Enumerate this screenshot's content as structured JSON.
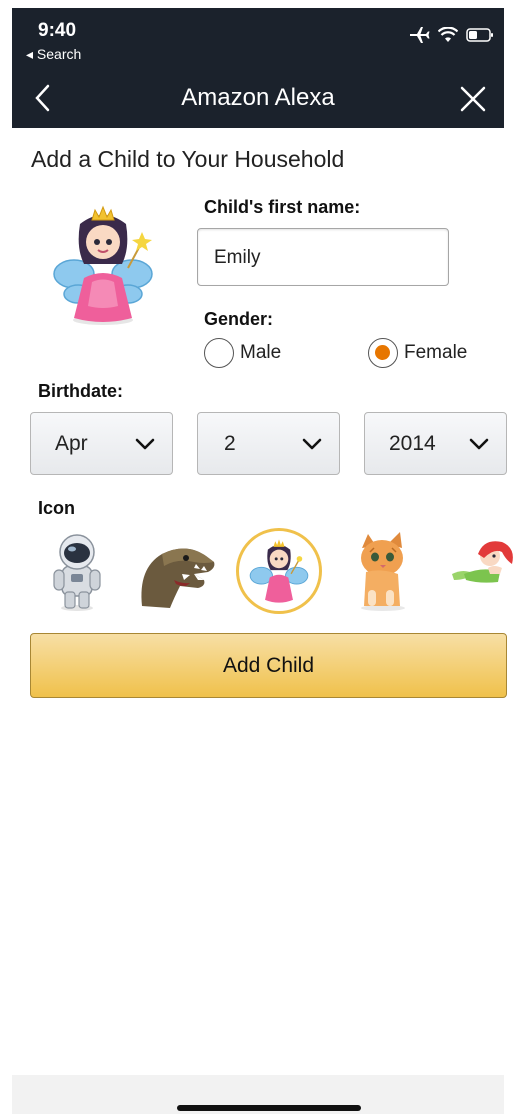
{
  "status_bar": {
    "time": "9:40",
    "back_app": "◂ Search"
  },
  "nav": {
    "title": "Amazon Alexa"
  },
  "page": {
    "heading": "Add a Child to Your Household"
  },
  "form": {
    "first_name_label": "Child's first name:",
    "first_name_value": "Emily",
    "gender_label": "Gender:",
    "gender_options": [
      {
        "label": "Male",
        "selected": false
      },
      {
        "label": "Female",
        "selected": true
      }
    ],
    "birthdate_label": "Birthdate:",
    "birth_month": "Apr",
    "birth_day": "2",
    "birth_year": "2014",
    "icon_label": "Icon",
    "icons": [
      "astronaut-icon",
      "dinosaur-icon",
      "fairy-princess-icon",
      "kitten-icon",
      "mermaid-icon"
    ],
    "selected_icon": "fairy-princess-icon",
    "submit_label": "Add Child"
  },
  "colors": {
    "nav_bg": "#1b222c",
    "accent_orange": "#e77600",
    "button_yellow": "#f0c14b",
    "selected_ring": "#f0c14b"
  }
}
